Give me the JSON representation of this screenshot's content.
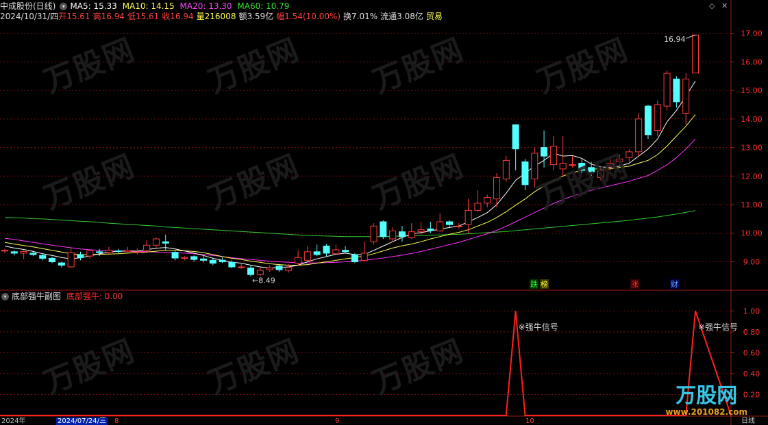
{
  "header": {
    "title": "中成股份(日线)",
    "ma5": "MA5: 15.33",
    "ma10": "MA10: 14.15",
    "ma20": "MA20: 13.30",
    "ma60": "MA60: 10.79",
    "date": "2024/10/31/四",
    "open": "开15.61",
    "high": "高16.94",
    "low": "低15.61",
    "close": "收16.94",
    "volume": "量216008",
    "amount": "额3.59亿",
    "range": "幅1.54(10.00%)",
    "turnover": "换7.01%",
    "float": "流通3.08亿",
    "sector": "贸易"
  },
  "colors": {
    "up": "#ff3c3c",
    "down": "#54ffff",
    "ma5": "#ffffff",
    "ma10": "#ffff55",
    "ma20": "#ff33ff",
    "ma60": "#33cc33",
    "grid": "#7a1010",
    "signal": "#ff2020"
  },
  "sub": {
    "title": "底部强牛副图",
    "value": "底部强牛: 0.00",
    "signal_label": "※强牛信号"
  },
  "axis": {
    "date_start": "2024年",
    "date_current": "2024/07/24/三",
    "date_label_8": "8",
    "date_label_9": "9",
    "date_label_10": "10",
    "period": "日线"
  },
  "markers": {
    "high_label": "16.94",
    "low_label": "8.49",
    "die": "跌",
    "bang": "榜",
    "zhang": "涨",
    "cai": "财"
  },
  "watermark": {
    "text": "万股网",
    "logo_big": "万股网",
    "logo_small": "www.201082.com"
  },
  "chart_data": {
    "type": "candlestick",
    "main_yticks": [
      "17.00",
      "16.00",
      "15.00",
      "14.00",
      "13.00",
      "12.00",
      "11.00",
      "10.00",
      "9.00"
    ],
    "sub_yticks": [
      "1.00",
      "0.80",
      "0.60",
      "0.40",
      "0.20"
    ],
    "ylim_main": [
      8.1,
      17.4
    ],
    "ylim_sub": [
      0,
      1.12
    ],
    "candles": [
      [
        9.38,
        9.4,
        9.3,
        9.45
      ],
      [
        9.35,
        9.3,
        9.22,
        9.4
      ],
      [
        9.3,
        9.36,
        9.1,
        9.4
      ],
      [
        9.3,
        9.25,
        9.2,
        9.35
      ],
      [
        9.22,
        9.12,
        9.05,
        9.28
      ],
      [
        9.12,
        9.0,
        8.95,
        9.18
      ],
      [
        8.96,
        8.88,
        8.8,
        9.0
      ],
      [
        8.82,
        9.32,
        8.78,
        9.5
      ],
      [
        9.25,
        9.15,
        9.05,
        9.35
      ],
      [
        9.2,
        9.38,
        9.1,
        9.4
      ],
      [
        9.35,
        9.32,
        9.2,
        9.45
      ],
      [
        9.33,
        9.4,
        9.28,
        9.52
      ],
      [
        9.38,
        9.36,
        9.3,
        9.45
      ],
      [
        9.35,
        9.4,
        9.3,
        9.52
      ],
      [
        9.35,
        9.35,
        9.25,
        9.47
      ],
      [
        9.4,
        9.58,
        9.3,
        9.75
      ],
      [
        9.58,
        9.8,
        9.5,
        9.85
      ],
      [
        9.7,
        9.65,
        9.4,
        9.95
      ],
      [
        9.33,
        9.13,
        9.05,
        9.38
      ],
      [
        9.12,
        9.15,
        9.05,
        9.2
      ],
      [
        9.18,
        9.08,
        9.0,
        9.22
      ],
      [
        9.1,
        9.05,
        8.98,
        9.2
      ],
      [
        9.05,
        8.95,
        8.88,
        9.12
      ],
      [
        9.05,
        9.0,
        8.95,
        9.15
      ],
      [
        8.98,
        8.82,
        8.78,
        9.05
      ],
      [
        8.8,
        8.82,
        8.75,
        8.92
      ],
      [
        8.78,
        8.55,
        8.49,
        8.85
      ],
      [
        8.55,
        8.7,
        8.49,
        8.8
      ],
      [
        8.72,
        8.78,
        8.65,
        8.88
      ],
      [
        8.85,
        8.72,
        8.65,
        8.92
      ],
      [
        8.7,
        8.8,
        8.62,
        8.92
      ],
      [
        8.95,
        9.15,
        8.85,
        9.4
      ],
      [
        9.05,
        9.35,
        9.0,
        9.55
      ],
      [
        9.35,
        9.25,
        9.2,
        9.6
      ],
      [
        9.55,
        9.3,
        9.2,
        9.62
      ],
      [
        9.28,
        9.42,
        9.25,
        9.6
      ],
      [
        9.4,
        9.35,
        9.3,
        9.55
      ],
      [
        9.25,
        9.0,
        8.95,
        9.3
      ],
      [
        9.05,
        9.3,
        9.0,
        9.7
      ],
      [
        9.7,
        10.25,
        9.6,
        10.35
      ],
      [
        10.4,
        9.88,
        9.8,
        10.45
      ],
      [
        9.8,
        10.08,
        9.7,
        10.2
      ],
      [
        10.05,
        9.88,
        9.7,
        10.25
      ],
      [
        9.85,
        10.05,
        9.8,
        10.35
      ],
      [
        10.05,
        10.12,
        9.95,
        10.4
      ],
      [
        10.15,
        10.1,
        10.0,
        10.4
      ],
      [
        10.08,
        10.4,
        10.05,
        10.7
      ],
      [
        10.4,
        10.3,
        10.2,
        10.45
      ],
      [
        10.25,
        10.25,
        10.15,
        10.35
      ],
      [
        10.3,
        10.8,
        10.0,
        11.2
      ],
      [
        10.8,
        11.05,
        10.75,
        11.5
      ],
      [
        11.05,
        11.25,
        10.9,
        11.35
      ],
      [
        11.2,
        11.95,
        10.9,
        12.1
      ],
      [
        11.9,
        12.55,
        11.8,
        12.7
      ],
      [
        13.8,
        12.95,
        12.2,
        13.8
      ],
      [
        12.5,
        11.7,
        11.5,
        12.6
      ],
      [
        11.9,
        12.8,
        11.6,
        13.0
      ],
      [
        13.0,
        12.7,
        12.3,
        13.6
      ],
      [
        12.4,
        13.05,
        12.2,
        13.4
      ],
      [
        12.25,
        12.45,
        12.0,
        13.4
      ],
      [
        12.4,
        12.4,
        12.3,
        12.7
      ],
      [
        12.45,
        12.2,
        12.1,
        12.6
      ],
      [
        12.3,
        12.15,
        12.0,
        12.5
      ],
      [
        11.95,
        12.2,
        11.85,
        12.3
      ],
      [
        12.35,
        12.45,
        12.2,
        12.6
      ],
      [
        12.5,
        12.6,
        12.4,
        12.75
      ],
      [
        12.65,
        12.85,
        12.5,
        12.95
      ],
      [
        12.85,
        14.0,
        12.7,
        14.2
      ],
      [
        14.45,
        13.45,
        13.3,
        14.5
      ],
      [
        13.6,
        14.5,
        13.4,
        14.65
      ],
      [
        14.45,
        15.6,
        14.3,
        15.7
      ],
      [
        15.4,
        14.6,
        14.4,
        15.5
      ],
      [
        14.2,
        15.4,
        13.8,
        15.6
      ],
      [
        15.61,
        16.94,
        15.61,
        16.94
      ]
    ],
    "ma5": [
      9.55,
      9.48,
      9.43,
      9.36,
      9.28,
      9.22,
      9.15,
      9.1,
      9.14,
      9.2,
      9.28,
      9.33,
      9.37,
      9.38,
      9.37,
      9.42,
      9.47,
      9.5,
      9.45,
      9.38,
      9.3,
      9.22,
      9.12,
      9.05,
      8.98,
      8.95,
      8.88,
      8.82,
      8.78,
      8.8,
      8.82,
      8.88,
      9.0,
      9.1,
      9.18,
      9.26,
      9.3,
      9.25,
      9.25,
      9.4,
      9.55,
      9.7,
      9.85,
      9.98,
      10.02,
      10.08,
      10.14,
      10.2,
      10.25,
      10.4,
      10.55,
      10.72,
      11.0,
      11.4,
      11.85,
      12.1,
      12.35,
      12.55,
      12.8,
      12.7,
      12.72,
      12.62,
      12.42,
      12.32,
      12.3,
      12.35,
      12.45,
      12.7,
      12.95,
      13.3,
      13.9,
      14.3,
      14.8,
      15.33
    ],
    "ma10": [
      9.68,
      9.62,
      9.57,
      9.52,
      9.46,
      9.4,
      9.34,
      9.28,
      9.25,
      9.25,
      9.26,
      9.27,
      9.28,
      9.3,
      9.32,
      9.34,
      9.37,
      9.4,
      9.4,
      9.38,
      9.36,
      9.32,
      9.25,
      9.18,
      9.12,
      9.08,
      9.02,
      8.98,
      8.93,
      8.9,
      8.88,
      8.88,
      8.9,
      8.95,
      9.0,
      9.05,
      9.1,
      9.15,
      9.2,
      9.28,
      9.38,
      9.48,
      9.56,
      9.62,
      9.7,
      9.8,
      9.88,
      9.96,
      10.03,
      10.12,
      10.25,
      10.38,
      10.55,
      10.75,
      10.98,
      11.2,
      11.45,
      11.65,
      11.85,
      12.0,
      12.12,
      12.2,
      12.25,
      12.25,
      12.25,
      12.3,
      12.35,
      12.45,
      12.55,
      12.75,
      13.05,
      13.4,
      13.75,
      14.15
    ],
    "ma20": [
      9.82,
      9.78,
      9.73,
      9.68,
      9.63,
      9.58,
      9.53,
      9.49,
      9.45,
      9.42,
      9.4,
      9.38,
      9.37,
      9.36,
      9.36,
      9.35,
      9.34,
      9.33,
      9.32,
      9.3,
      9.28,
      9.25,
      9.22,
      9.18,
      9.14,
      9.11,
      9.08,
      9.05,
      9.02,
      9.0,
      8.98,
      8.97,
      8.96,
      8.96,
      8.97,
      8.98,
      9.0,
      9.02,
      9.05,
      9.09,
      9.13,
      9.18,
      9.23,
      9.29,
      9.36,
      9.44,
      9.52,
      9.6,
      9.68,
      9.78,
      9.88,
      9.98,
      10.1,
      10.24,
      10.4,
      10.56,
      10.72,
      10.88,
      11.04,
      11.18,
      11.3,
      11.4,
      11.5,
      11.58,
      11.66,
      11.74,
      11.82,
      11.92,
      12.02,
      12.2,
      12.4,
      12.65,
      12.95,
      13.3
    ],
    "ma60": [
      10.55,
      10.54,
      10.53,
      10.51,
      10.5,
      10.48,
      10.46,
      10.44,
      10.42,
      10.4,
      10.38,
      10.35,
      10.33,
      10.31,
      10.29,
      10.27,
      10.25,
      10.22,
      10.2,
      10.18,
      10.16,
      10.14,
      10.12,
      10.1,
      10.08,
      10.06,
      10.04,
      10.02,
      10.0,
      9.98,
      9.96,
      9.94,
      9.92,
      9.91,
      9.9,
      9.89,
      9.88,
      9.88,
      9.88,
      9.88,
      9.88,
      9.89,
      9.9,
      9.91,
      9.92,
      9.93,
      9.94,
      9.95,
      9.96,
      9.98,
      10.0,
      10.02,
      10.04,
      10.06,
      10.09,
      10.12,
      10.15,
      10.18,
      10.21,
      10.24,
      10.27,
      10.3,
      10.33,
      10.36,
      10.39,
      10.42,
      10.45,
      10.49,
      10.53,
      10.57,
      10.62,
      10.67,
      10.73,
      10.79
    ],
    "signal": [
      0,
      0,
      0,
      0,
      0,
      0,
      0,
      0,
      0,
      0,
      0,
      0,
      0,
      0,
      0,
      0,
      0,
      0,
      0,
      0,
      0,
      0,
      0,
      0,
      0,
      0,
      0,
      0,
      0,
      0,
      0,
      0,
      0,
      0,
      0,
      0,
      0,
      0,
      0,
      0,
      0,
      0,
      0,
      0,
      0,
      0,
      0,
      0,
      0,
      0,
      0,
      0,
      0,
      0,
      1,
      0,
      0,
      0,
      0,
      0,
      0,
      0,
      0,
      0,
      0,
      0,
      0,
      0,
      0,
      0,
      0,
      0,
      0,
      1
    ]
  }
}
